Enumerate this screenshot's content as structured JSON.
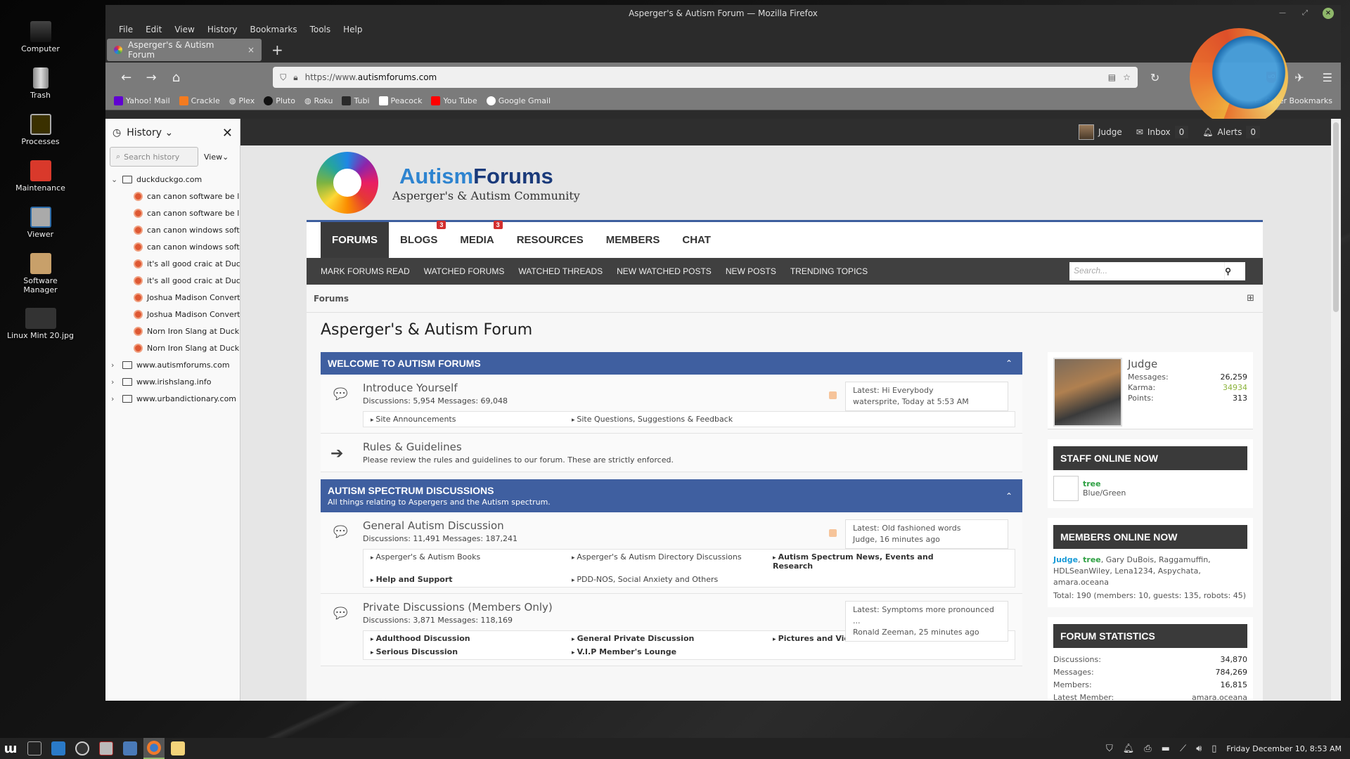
{
  "desktop": {
    "icons": [
      {
        "label": "Computer",
        "icon": "monitor-icon"
      },
      {
        "label": "Trash",
        "icon": "trash-icon"
      },
      {
        "label": "Processes",
        "icon": "system-monitor-icon"
      },
      {
        "label": "Maintenance",
        "icon": "broom-icon"
      },
      {
        "label": "Viewer",
        "icon": "viewer-icon"
      },
      {
        "label": "Software Manager",
        "icon": "package-icon"
      },
      {
        "label": "Linux Mint 20.jpg",
        "icon": "image-file-icon"
      }
    ]
  },
  "window": {
    "title": "Asperger's & Autism Forum — Mozilla Firefox",
    "menu": [
      "File",
      "Edit",
      "View",
      "History",
      "Bookmarks",
      "Tools",
      "Help"
    ],
    "tab": {
      "label": "Asperger's & Autism Forum",
      "close": "×"
    },
    "new_tab": "+",
    "url_prefix": "https://www.",
    "url_domain": "autismforums.com",
    "bookmarks": [
      {
        "label": "Yahoo! Mail",
        "color": "#6001d2"
      },
      {
        "label": "Crackle",
        "color": "#f47b20"
      },
      {
        "label": "Plex",
        "color": "#888888"
      },
      {
        "label": "Pluto",
        "color": "#111111"
      },
      {
        "label": "Roku",
        "color": "#888888"
      },
      {
        "label": "Tubi",
        "color": "#2a2a2a"
      },
      {
        "label": "Peacock",
        "color": "#ffffff"
      },
      {
        "label": "You Tube",
        "color": "#ff0000"
      },
      {
        "label": "Google Gmail",
        "color": "#ffffff"
      }
    ],
    "other_bookmarks": "Other Bookmarks"
  },
  "history_sidebar": {
    "title": "History",
    "search_placeholder": "Search history",
    "view_label": "View",
    "folders": [
      {
        "name": "duckduckgo.com",
        "expanded": true,
        "items": [
          "can canon software be l…",
          "can canon software be l…",
          "can canon windows soft…",
          "can canon windows soft…",
          "it's all good craic at Duc…",
          "it's all good craic at Duc…",
          "Joshua Madison Convert…",
          "Joshua Madison Convert…",
          "Norn Iron Slang at Duck…",
          "Norn Iron Slang at Duck…"
        ]
      },
      {
        "name": "www.autismforums.com",
        "expanded": false
      },
      {
        "name": "www.irishslang.info",
        "expanded": false
      },
      {
        "name": "www.urbandictionary.com",
        "expanded": false
      }
    ]
  },
  "forum": {
    "user_bar": {
      "username": "Judge",
      "inbox_label": "Inbox",
      "inbox_count": "0",
      "alerts_label": "Alerts",
      "alerts_count": "0"
    },
    "brand": {
      "part1": "Autism",
      "part2": "Forums",
      "tagline": "Asperger's & Autism Community"
    },
    "nav": [
      {
        "label": "FORUMS",
        "active": true,
        "badge": ""
      },
      {
        "label": "BLOGS",
        "active": false,
        "badge": "3"
      },
      {
        "label": "MEDIA",
        "active": false,
        "badge": "3"
      },
      {
        "label": "RESOURCES",
        "active": false,
        "badge": ""
      },
      {
        "label": "MEMBERS",
        "active": false,
        "badge": ""
      },
      {
        "label": "CHAT",
        "active": false,
        "badge": ""
      }
    ],
    "subnav": [
      "MARK FORUMS READ",
      "WATCHED FORUMS",
      "WATCHED THREADS",
      "NEW WATCHED POSTS",
      "NEW POSTS",
      "TRENDING TOPICS"
    ],
    "search_placeholder": "Search...",
    "breadcrumb": "Forums",
    "page_title": "Asperger's & Autism Forum",
    "categories": [
      {
        "title": "WELCOME TO AUTISM FORUMS",
        "desc": "",
        "nodes": [
          {
            "title": "Introduce Yourself",
            "stats": "Discussions: 5,954   Messages: 69,048",
            "latest_title": "Latest: Hi Everybody",
            "latest_meta": "watersprite, Today at 5:53 AM",
            "subforums": [
              {
                "label": "Site Announcements",
                "bold": false
              },
              {
                "label": "Site Questions, Suggestions & Feedback",
                "bold": false
              }
            ]
          },
          {
            "title": "Rules & Guidelines",
            "stats": "Please review the rules and guidelines to our forum. These are strictly enforced.",
            "link": true
          }
        ]
      },
      {
        "title": "AUTISM SPECTRUM DISCUSSIONS",
        "desc": "All things relating to Aspergers and the Autism spectrum.",
        "nodes": [
          {
            "title": "General Autism Discussion",
            "stats": "Discussions: 11,491   Messages: 187,241",
            "latest_title": "Latest: Old fashioned words",
            "latest_meta": "Judge, 16 minutes ago",
            "subforums": [
              {
                "label": "Asperger's & Autism Books",
                "bold": false
              },
              {
                "label": "Asperger's & Autism Directory Discussions",
                "bold": false
              },
              {
                "label": "Autism Spectrum News, Events and Research",
                "bold": true
              },
              {
                "label": "Help and Support",
                "bold": true
              },
              {
                "label": "PDD-NOS, Social Anxiety and Others",
                "bold": false
              }
            ]
          },
          {
            "title": "Private Discussions (Members Only)",
            "stats": "Discussions: 3,871   Messages: 118,169",
            "latest_title": "Latest: Symptoms more pronounced ...",
            "latest_meta": "Ronald Zeeman, 25 minutes ago",
            "subforums": [
              {
                "label": "Adulthood Discussion",
                "bold": true
              },
              {
                "label": "General Private Discussion",
                "bold": true
              },
              {
                "label": "Pictures and Videos Vault",
                "bold": true
              },
              {
                "label": "Serious Discussion",
                "bold": true
              },
              {
                "label": "V.I.P Member's Lounge",
                "bold": true
              }
            ]
          }
        ]
      }
    ],
    "profile": {
      "name": "Judge",
      "messages_label": "Messages:",
      "messages": "26,259",
      "karma_label": "Karma:",
      "karma": "34934",
      "points_label": "Points:",
      "points": "313"
    },
    "staff_online": {
      "title": "STAFF ONLINE NOW",
      "name": "tree",
      "title_text": "Blue/Green"
    },
    "members_online": {
      "title": "MEMBERS ONLINE NOW",
      "first": "Judge",
      "second": "tree",
      "rest": ", Gary DuBois, Raggamuffin, HDLSeanWiley, Lena1234, Aspychata, amara.oceana",
      "total": "Total: 190 (members: 10, guests: 135, robots: 45)"
    },
    "stats": {
      "title": "FORUM STATISTICS",
      "rows": [
        {
          "label": "Discussions:",
          "value": "34,870"
        },
        {
          "label": "Messages:",
          "value": "784,269"
        },
        {
          "label": "Members:",
          "value": "16,815"
        },
        {
          "label": "Latest Member:",
          "value": "amara.oceana"
        }
      ]
    }
  },
  "taskbar": {
    "apps": [
      "mint-menu",
      "terminal",
      "media-player",
      "app-a",
      "eye-app",
      "thunderbird",
      "firefox",
      "files"
    ],
    "clock": "Friday December 10,  8:53 AM"
  }
}
